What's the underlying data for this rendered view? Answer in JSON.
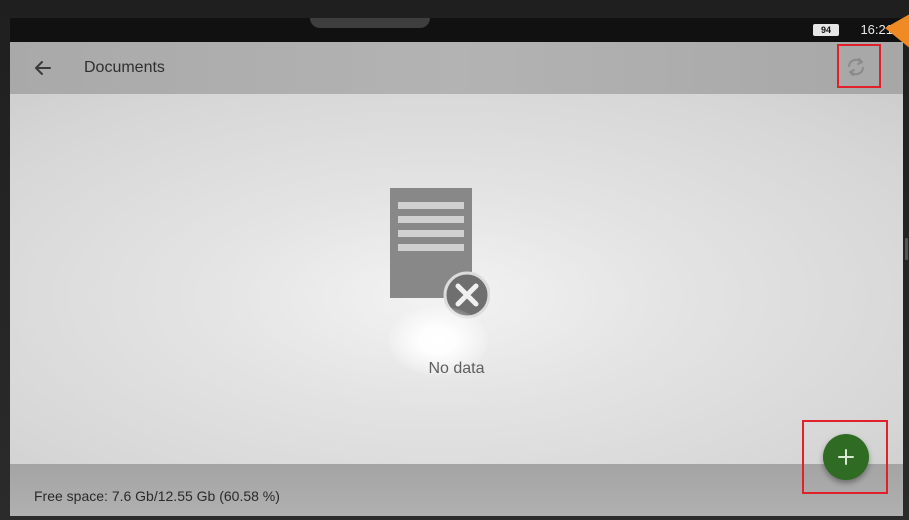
{
  "status_bar": {
    "battery_level": "94",
    "time": "16:21"
  },
  "app_bar": {
    "title": "Documents",
    "back_icon": "arrow-left-icon",
    "refresh_icon": "refresh-icon"
  },
  "content": {
    "empty_icon": "document-error-icon",
    "empty_message": "No data"
  },
  "footer": {
    "free_space": "Free space: 7.6 Gb/12.55 Gb (60.58 %)"
  },
  "fab": {
    "icon": "plus-icon"
  },
  "colors": {
    "app_bar": "#adadad",
    "fab": "#2f6b22",
    "highlight": "#e0202a",
    "pointer": "#f08a24"
  }
}
